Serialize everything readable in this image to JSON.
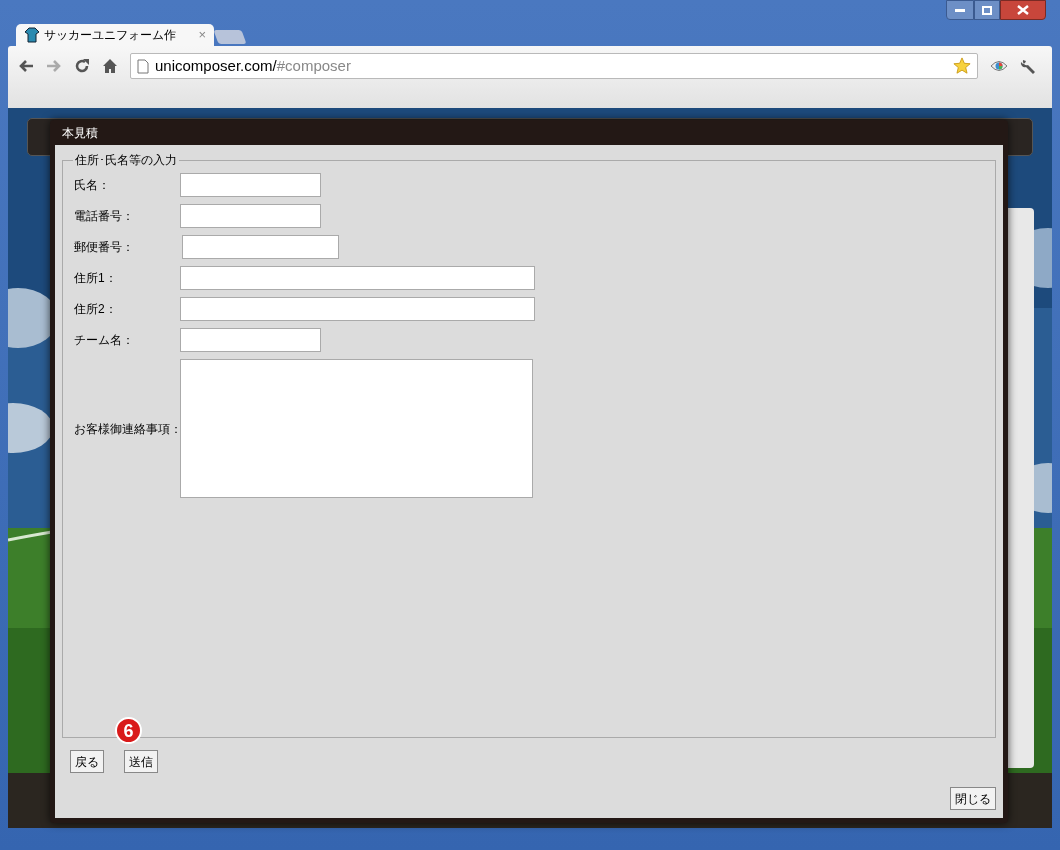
{
  "browser": {
    "tabs": [
      {
        "title": "サッカーユニフォーム作",
        "selected": true
      }
    ],
    "close_tab": "×",
    "address": {
      "host": "unicomposer.com/",
      "path": "#composer"
    }
  },
  "dialog": {
    "title": "本見積",
    "legend": "住所･氏名等の入力",
    "fields": [
      {
        "label": "氏名：",
        "kind": "short"
      },
      {
        "label": "電話番号：",
        "kind": "short"
      },
      {
        "label": "郵便番号：",
        "kind": "medium"
      },
      {
        "label": "住所1：",
        "kind": "long"
      },
      {
        "label": "住所2：",
        "kind": "long"
      },
      {
        "label": "チーム名：",
        "kind": "short"
      },
      {
        "label": "お客様御連絡事項：",
        "kind": "textarea"
      }
    ],
    "buttons": [
      {
        "label": "戻る"
      },
      {
        "label": "送信",
        "badge": "6"
      }
    ],
    "close_button": "閉じる"
  }
}
